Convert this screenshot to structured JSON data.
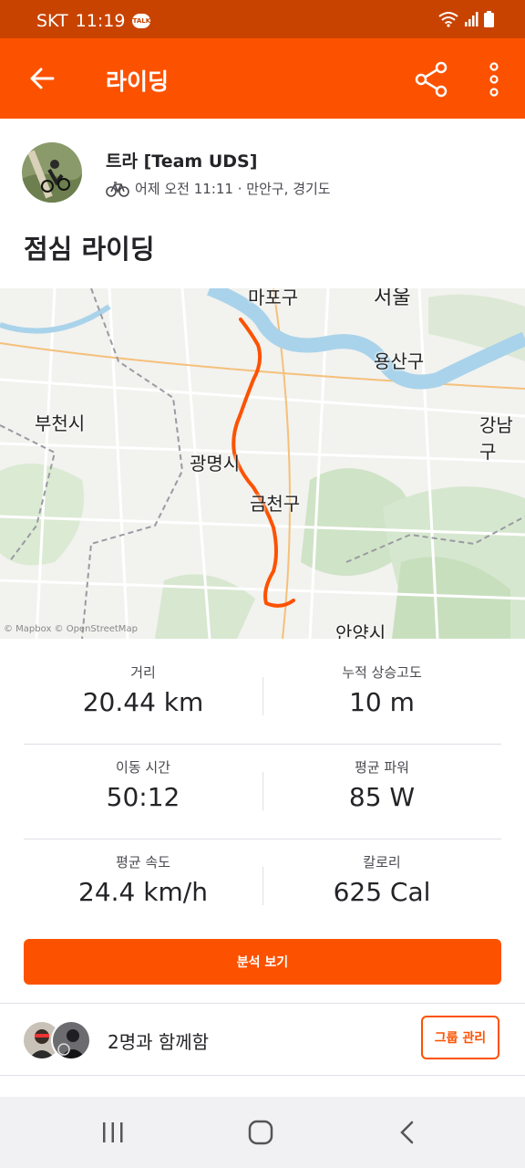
{
  "status_bar": {
    "carrier": "SKT",
    "time": "11:19",
    "talk_badge": "TALK"
  },
  "app_bar": {
    "title": "라이딩"
  },
  "activity": {
    "athlete_name": "트라 [Team UDS]",
    "meta": "어제 오전 11:11 · 만안구, 경기도",
    "title": "점심 라이딩"
  },
  "map": {
    "labels": [
      "마포구",
      "서울",
      "용산구",
      "부천시",
      "강남구",
      "광명시",
      "금천구",
      "안양시"
    ],
    "attribution": "© Mapbox © OpenStreetMap",
    "route_color": "#fc5200"
  },
  "stats": [
    {
      "label": "거리",
      "value": "20.44 km"
    },
    {
      "label": "누적 상승고도",
      "value": "10 m"
    },
    {
      "label": "이동 시간",
      "value": "50:12"
    },
    {
      "label": "평균 파워",
      "value": "85 W"
    },
    {
      "label": "평균 속도",
      "value": "24.4 km/h"
    },
    {
      "label": "칼로리",
      "value": "625 Cal"
    }
  ],
  "analysis_button": "분석 보기",
  "group": {
    "text": "2명과 함께함",
    "button": "그룹 관리"
  },
  "colors": {
    "brand": "#fc5200",
    "status_bar": "#c94300"
  }
}
